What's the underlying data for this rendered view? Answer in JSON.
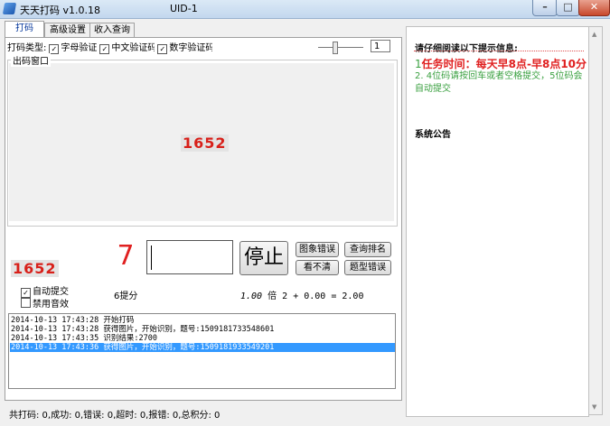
{
  "window": {
    "title": "天天打码 v1.0.18",
    "uid": "UID-1"
  },
  "tabs": [
    {
      "label": "打码"
    },
    {
      "label": "高级设置"
    },
    {
      "label": "收入查询"
    }
  ],
  "captcha_types": {
    "label": "打码类型:",
    "options": [
      "字母验证",
      "中文验证码",
      "数字验证码"
    ]
  },
  "speed": {
    "value": "1"
  },
  "output": {
    "label": "出码窗口",
    "captcha_text": "1652"
  },
  "preview": {
    "captcha_text": "1652"
  },
  "countdown": "7",
  "answer": {
    "value": ""
  },
  "buttons": {
    "stop": "停止",
    "image_error": "图象错误",
    "rank": "查询排名",
    "unclear": "看不清",
    "type_error": "题型错误"
  },
  "options": {
    "auto_submit": "自动提交",
    "mute": "禁用音效"
  },
  "score": {
    "label": "6提分",
    "multiplier": "1.00",
    "times_label": "倍",
    "formula": "2 + 0.00 = 2.00"
  },
  "log": [
    {
      "time": "2014-10-13 17:43:28",
      "text": "开始打码"
    },
    {
      "time": "2014-10-13 17:43:28",
      "text": "获得图片，开始识别，题号:1509181733548601"
    },
    {
      "time": "2014-10-13 17:43:35",
      "text": "识别结果:2700"
    },
    {
      "time": "2014-10-13 17:43:36",
      "text": "获得图片，开始识别，题号:1509181933549201"
    }
  ],
  "status": "共打码: 0,成功: 0,错误: 0,超时: 0,报错: 0,总积分: 0",
  "notice": {
    "heading": "请仔细阅读以下提示信息:",
    "item1_num": "1",
    "item1": "任务时间：每天早8点-早8点10分",
    "item2": "2. 4位码请按回车或者空格提交，5位码会自动提交",
    "system_title": "系统公告"
  }
}
